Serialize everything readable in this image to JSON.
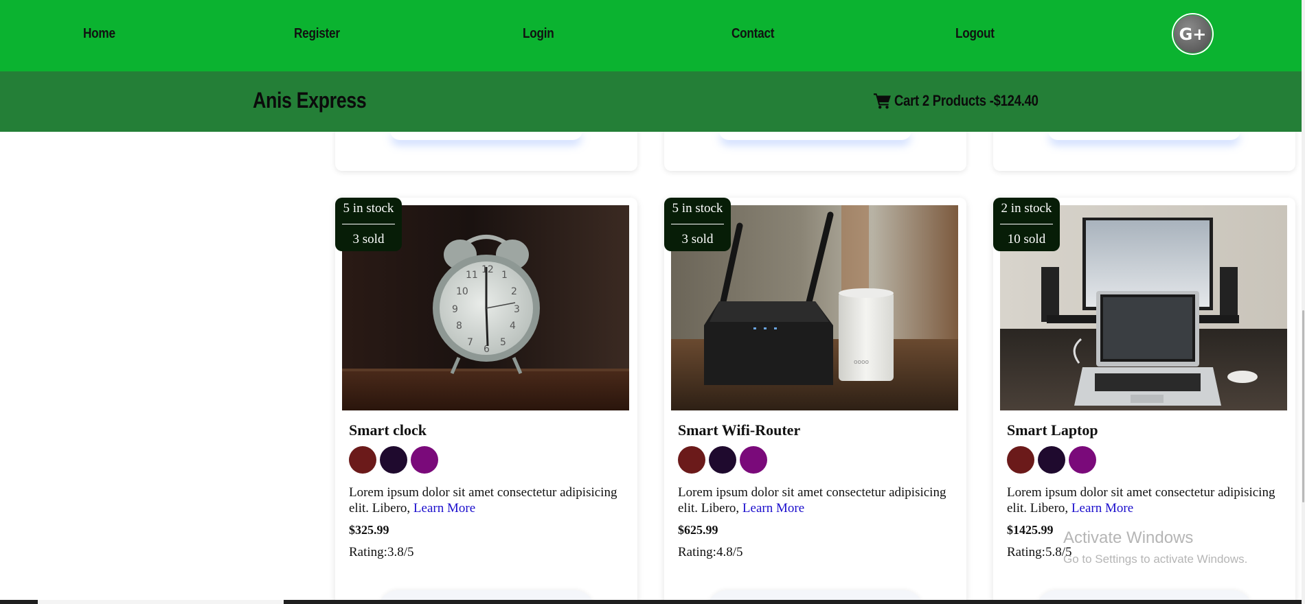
{
  "nav": {
    "links": [
      "Home",
      "Register",
      "Login",
      "Contact",
      "Logout"
    ],
    "social_icon": "google-plus-icon",
    "social_glyph": "G+"
  },
  "header": {
    "brand": "Anis Express",
    "cart_icon": "shopping-cart-icon",
    "cart_text": "Cart 2 Products -$124.40"
  },
  "products": [
    {
      "title": "Smart clock",
      "image": "alarm-clock-photo",
      "stock": "5 in stock",
      "sold": "3 sold",
      "colors": [
        "#6b1a1a",
        "#1f0a2e",
        "#7a0a7a"
      ],
      "description": "Lorem ipsum dolor sit amet consectetur adipisicing elit. Libero,",
      "learn_more": "Learn More",
      "price": "$325.99",
      "rating": "Rating:3.8/5"
    },
    {
      "title": "Smart Wifi-Router",
      "image": "wifi-router-photo",
      "stock": "5 in stock",
      "sold": "3 sold",
      "colors": [
        "#6b1a1a",
        "#1f0a2e",
        "#7a0a7a"
      ],
      "description": "Lorem ipsum dolor sit amet consectetur adipisicing elit. Libero,",
      "learn_more": "Learn More",
      "price": "$625.99",
      "rating": "Rating:4.8/5"
    },
    {
      "title": "Smart Laptop",
      "image": "laptop-photo",
      "stock": "2 in stock",
      "sold": "10 sold",
      "colors": [
        "#6b1a1a",
        "#1f0a2e",
        "#7a0a7a"
      ],
      "description": "Lorem ipsum dolor sit amet consectetur adipisicing elit. Libero,",
      "learn_more": "Learn More",
      "price": "$1425.99",
      "rating": "Rating:5.8/5"
    }
  ],
  "watermark": {
    "title": "Activate Windows",
    "subtitle": "Go to Settings to activate Windows."
  }
}
